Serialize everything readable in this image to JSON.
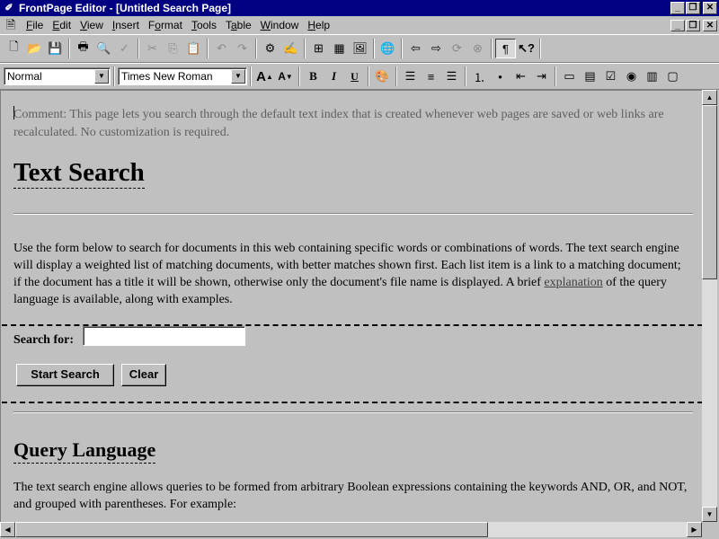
{
  "titlebar": {
    "title": "FrontPage Editor - [Untitled Search Page]"
  },
  "menu": {
    "items": [
      {
        "label": "File",
        "acc": "F",
        "rest": "ile"
      },
      {
        "label": "Edit",
        "acc": "E",
        "rest": "dit"
      },
      {
        "label": "View",
        "acc": "V",
        "rest": "iew"
      },
      {
        "label": "Insert",
        "acc": "I",
        "rest": "nsert"
      },
      {
        "label": "Format",
        "pre": "F",
        "acc": "o",
        "rest": "rmat"
      },
      {
        "label": "Tools",
        "acc": "T",
        "rest": "ools"
      },
      {
        "label": "Table",
        "pre": "T",
        "acc": "a",
        "rest": "ble"
      },
      {
        "label": "Window",
        "acc": "W",
        "rest": "indow"
      },
      {
        "label": "Help",
        "acc": "H",
        "rest": "elp"
      }
    ]
  },
  "format_toolbar": {
    "style_value": "Normal",
    "font_value": "Times New Roman",
    "bold": "B",
    "italic": "I",
    "underline": "U"
  },
  "document": {
    "comment": "Comment: This page lets you search through the default text index that is created whenever web pages are saved or web links are recalculated. No customization is required.",
    "heading": "Text Search",
    "intro_before_link": "Use the form below to search for documents in this web containing specific words or combinations of words. The text search engine will display a weighted list of matching documents, with better matches shown first. Each list item is a link to a matching document; if the document has a title it will be shown, otherwise only the document's file name is displayed. A brief ",
    "intro_link": "explanation",
    "intro_after_link": " of the query language is available, along with examples.",
    "search_label": "Search for:",
    "start_button": "Start Search",
    "clear_button": "Clear",
    "query_heading": "Query Language",
    "query_text": "The text search engine allows queries to be formed from arbitrary Boolean expressions containing the keywords AND, OR, and NOT, and grouped with parentheses. For example:"
  }
}
